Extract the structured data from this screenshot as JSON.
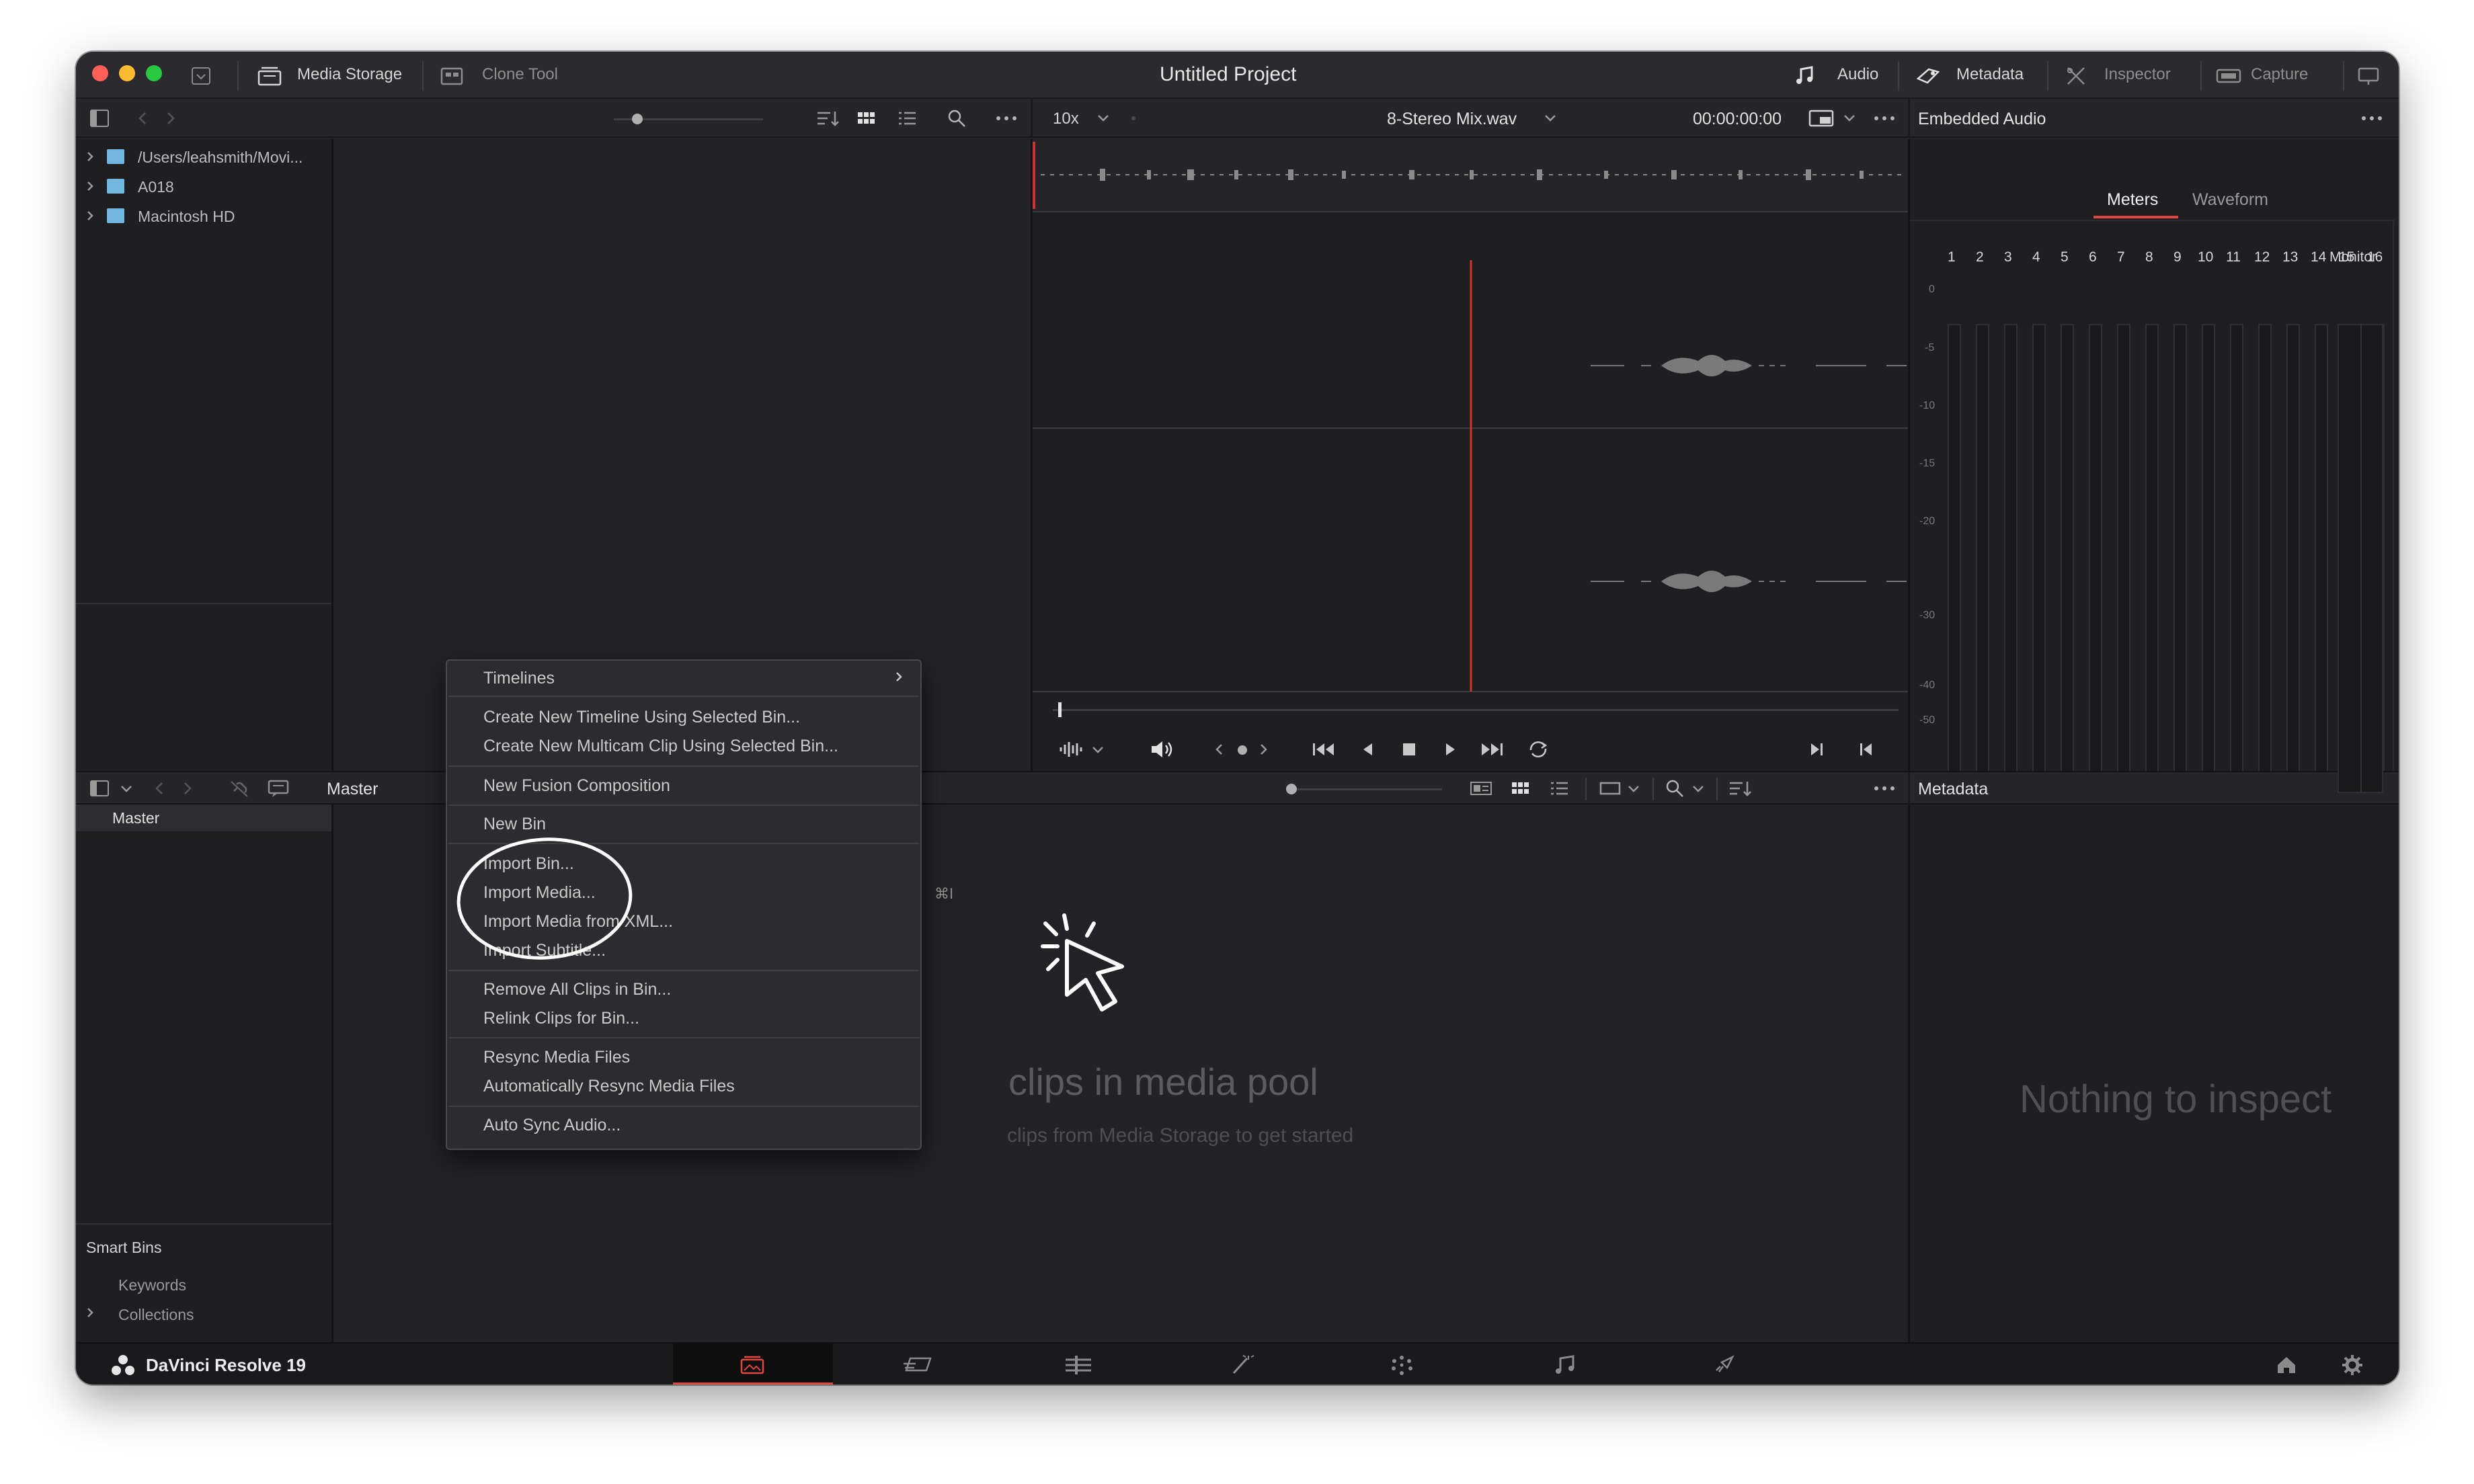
{
  "window": {
    "title": "Untitled Project",
    "tabs_left": [
      {
        "label": "Media Storage",
        "icon": "media-storage-icon"
      },
      {
        "label": "Clone Tool",
        "icon": "clone-tool-icon"
      }
    ],
    "tabs_right": [
      {
        "label": "Audio",
        "icon": "music-note-icon"
      },
      {
        "label": "Metadata",
        "icon": "metadata-icon"
      },
      {
        "label": "Inspector",
        "icon": "inspector-icon"
      },
      {
        "label": "Capture",
        "icon": "capture-icon"
      }
    ]
  },
  "viewer": {
    "zoom": "10x",
    "clip_name": "8-Stereo Mix.wav",
    "timecode": "00:00:00:00"
  },
  "media_storage": {
    "items": [
      "/Users/leahsmith/Movi...",
      "A018",
      "Macintosh HD"
    ]
  },
  "audio_panel": {
    "title": "Embedded Audio",
    "tabs": [
      "Meters",
      "Waveform"
    ],
    "active_tab": "Meters",
    "channels": [
      "1",
      "2",
      "3",
      "4",
      "5",
      "6",
      "7",
      "8",
      "9",
      "10",
      "11",
      "12",
      "13",
      "14",
      "15",
      "16"
    ],
    "monitor_label": "Monitor",
    "scale": [
      "0",
      "-5",
      "-10",
      "-15",
      "-20",
      "-30",
      "-40",
      "-50"
    ]
  },
  "media_pool": {
    "bin_title": "Master",
    "master_item": "Master",
    "smart_bins_label": "Smart Bins",
    "smart_bins": [
      "Keywords",
      "Collections"
    ],
    "empty_title": "clips in media pool",
    "empty_subtitle": "clips from Media Storage to get started"
  },
  "metadata_panel": {
    "title": "Metadata",
    "empty": "Nothing to inspect"
  },
  "context_menu": {
    "timelines": "Timelines",
    "create_timeline": "Create New Timeline Using Selected Bin...",
    "create_multicam": "Create New Multicam Clip Using Selected Bin...",
    "new_fusion": "New Fusion Composition",
    "new_bin": "New Bin",
    "import_bin": "Import Bin...",
    "import_media": "Import Media...",
    "import_media_shortcut": "⌘I",
    "import_xml": "Import Media from XML...",
    "import_subtitle": "Import Subtitle...",
    "remove_all": "Remove All Clips in Bin...",
    "relink": "Relink Clips for Bin...",
    "resync": "Resync Media Files",
    "auto_resync": "Automatically Resync Media Files",
    "auto_sync_audio": "Auto Sync Audio..."
  },
  "footer": {
    "app_name": "DaVinci Resolve 19",
    "pages": [
      "media-page-icon",
      "cut-page-icon",
      "edit-page-icon",
      "fusion-page-icon",
      "color-page-icon",
      "fairlight-page-icon",
      "deliver-page-icon"
    ],
    "active_page": "media-page-icon"
  },
  "colors": {
    "accent_red": "#e0463e",
    "playhead": "#d2332c",
    "background": "#232327"
  }
}
